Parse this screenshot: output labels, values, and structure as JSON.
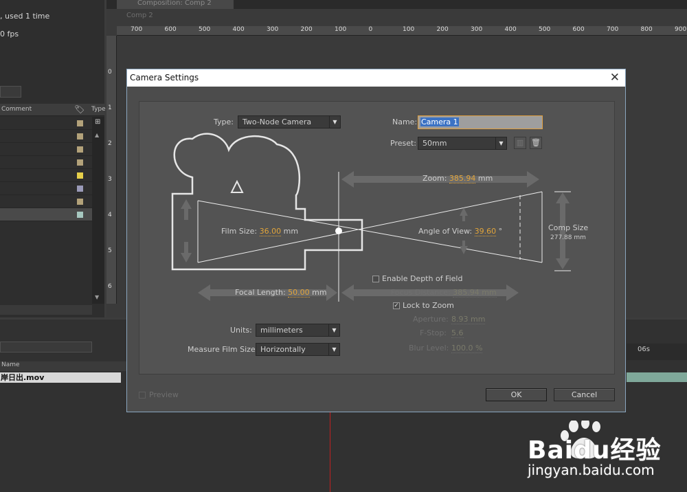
{
  "project": {
    "info_line1": ", used 1 time",
    "info_line2": "0 fps",
    "comment_header": "Comment",
    "type_header": "Type",
    "row_colors": [
      "#b3a27a",
      "#b3a27a",
      "#b3a27a",
      "#b3a27a",
      "#e6cf4a",
      "#9a9ab8",
      "#b3a27a",
      "#a7c8c0"
    ]
  },
  "comp": {
    "tab_label": "Composition: Comp 2",
    "breadcrumb": "Comp 2",
    "ruler_top": [
      "700",
      "600",
      "500",
      "400",
      "300",
      "200",
      "100",
      "0",
      "100",
      "200",
      "300",
      "400",
      "500",
      "600",
      "700",
      "800",
      "900"
    ],
    "ruler_left": [
      "0",
      "1",
      "2",
      "3",
      "4",
      "5",
      "6"
    ]
  },
  "timeline": {
    "name_header": "Name",
    "layer_name": "岸日出.mov",
    "time_label": "06s"
  },
  "dialog": {
    "title": "Camera Settings",
    "type_label": "Type:",
    "type_value": "Two-Node Camera",
    "name_label": "Name:",
    "name_value": "Camera 1",
    "preset_label": "Preset:",
    "preset_value": "50mm",
    "zoom_label": "Zoom:",
    "zoom_value": "385.94",
    "zoom_unit": "mm",
    "film_size_label": "Film Size:",
    "film_size_value": "36.00",
    "film_size_unit": "mm",
    "angle_label": "Angle of View:",
    "angle_value": "39.60",
    "angle_unit": "°",
    "comp_size_label": "Comp Size",
    "comp_size_value": "277.88 mm",
    "dof_label": "Enable Depth of Field",
    "focal_label": "Focal Length:",
    "focal_value": "50.00",
    "focal_unit": "mm",
    "focus_distance_label": "Focus Distance:",
    "focus_distance_value": "385.94 mm",
    "lock_zoom_label": "Lock to Zoom",
    "aperture_label": "Aperture:",
    "aperture_value": "8.93 mm",
    "fstop_label": "F-Stop:",
    "fstop_value": "5.6",
    "blur_label": "Blur Level:",
    "blur_value": "100.0 %",
    "units_label": "Units:",
    "units_value": "millimeters",
    "measure_label": "Measure Film Size:",
    "measure_value": "Horizontally",
    "preview_label": "Preview",
    "ok_label": "OK",
    "cancel_label": "Cancel"
  },
  "watermark": {
    "brand": "Baidu经验",
    "url": "jingyan.baidu.com"
  }
}
